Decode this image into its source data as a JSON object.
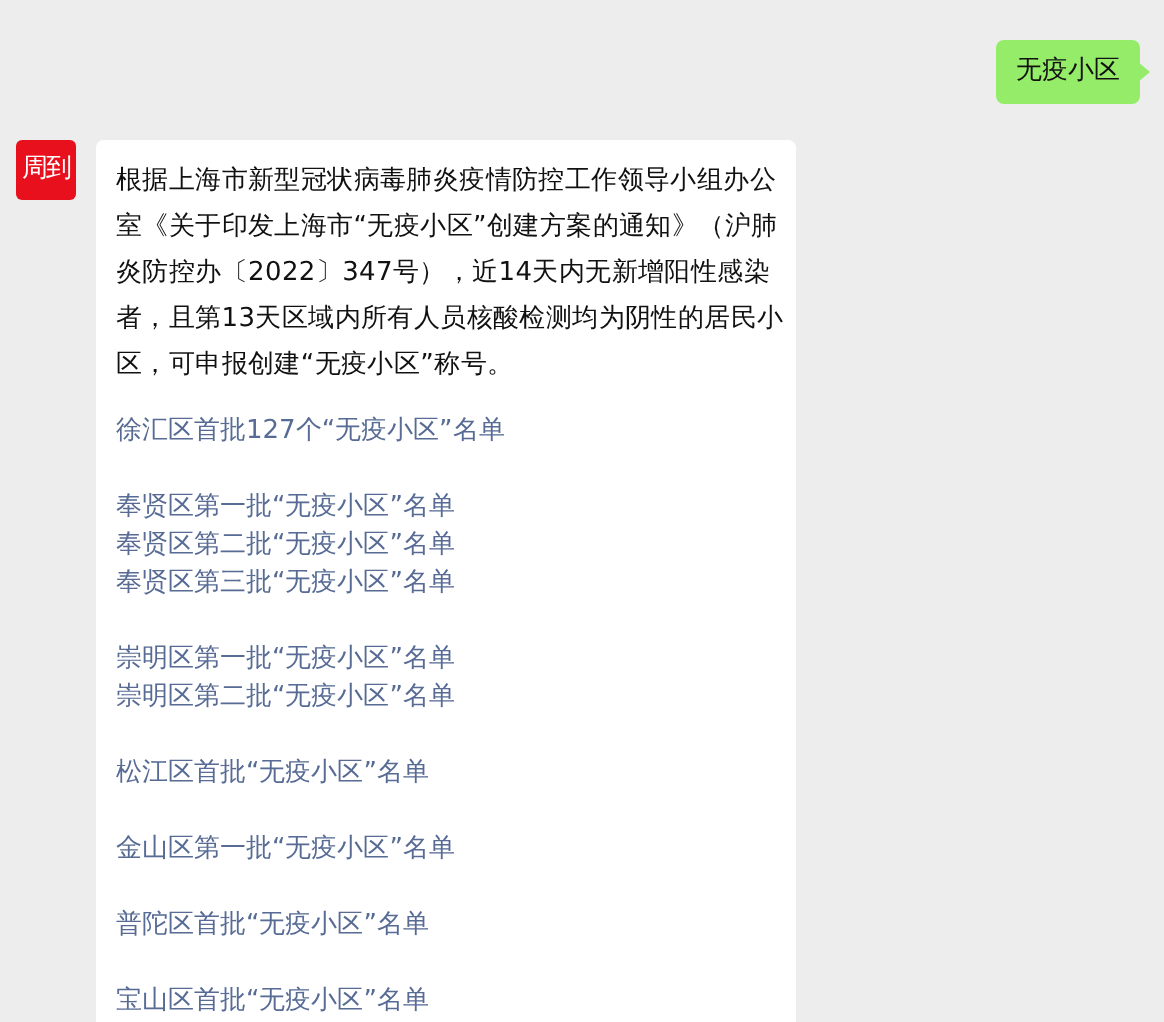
{
  "outgoing": {
    "text": "无疫小区"
  },
  "incoming": {
    "avatar_text": "周到",
    "paragraph": "根据上海市新型冠状病毒肺炎疫情防控工作领导小组办公室《关于印发上海市“无疫小区”创建方案的通知》（沪肺炎防控办〔2022〕347号），近14天内无新增阳性感染者，且第13天区域内所有人员核酸检测均为阴性的居民小区，可申报创建“无疫小区”称号。",
    "link_groups": [
      [
        "徐汇区首批127个“无疫小区”名单"
      ],
      [
        "奉贤区第一批“无疫小区”名单",
        "奉贤区第二批“无疫小区”名单",
        "奉贤区第三批“无疫小区”名单"
      ],
      [
        "崇明区第一批“无疫小区”名单",
        "崇明区第二批“无疫小区”名单"
      ],
      [
        "松江区首批“无疫小区”名单"
      ],
      [
        "金山区第一批“无疫小区”名单"
      ],
      [
        "普陀区首批“无疫小区”名单"
      ],
      [
        "宝山区首批“无疫小区”名单"
      ]
    ]
  }
}
